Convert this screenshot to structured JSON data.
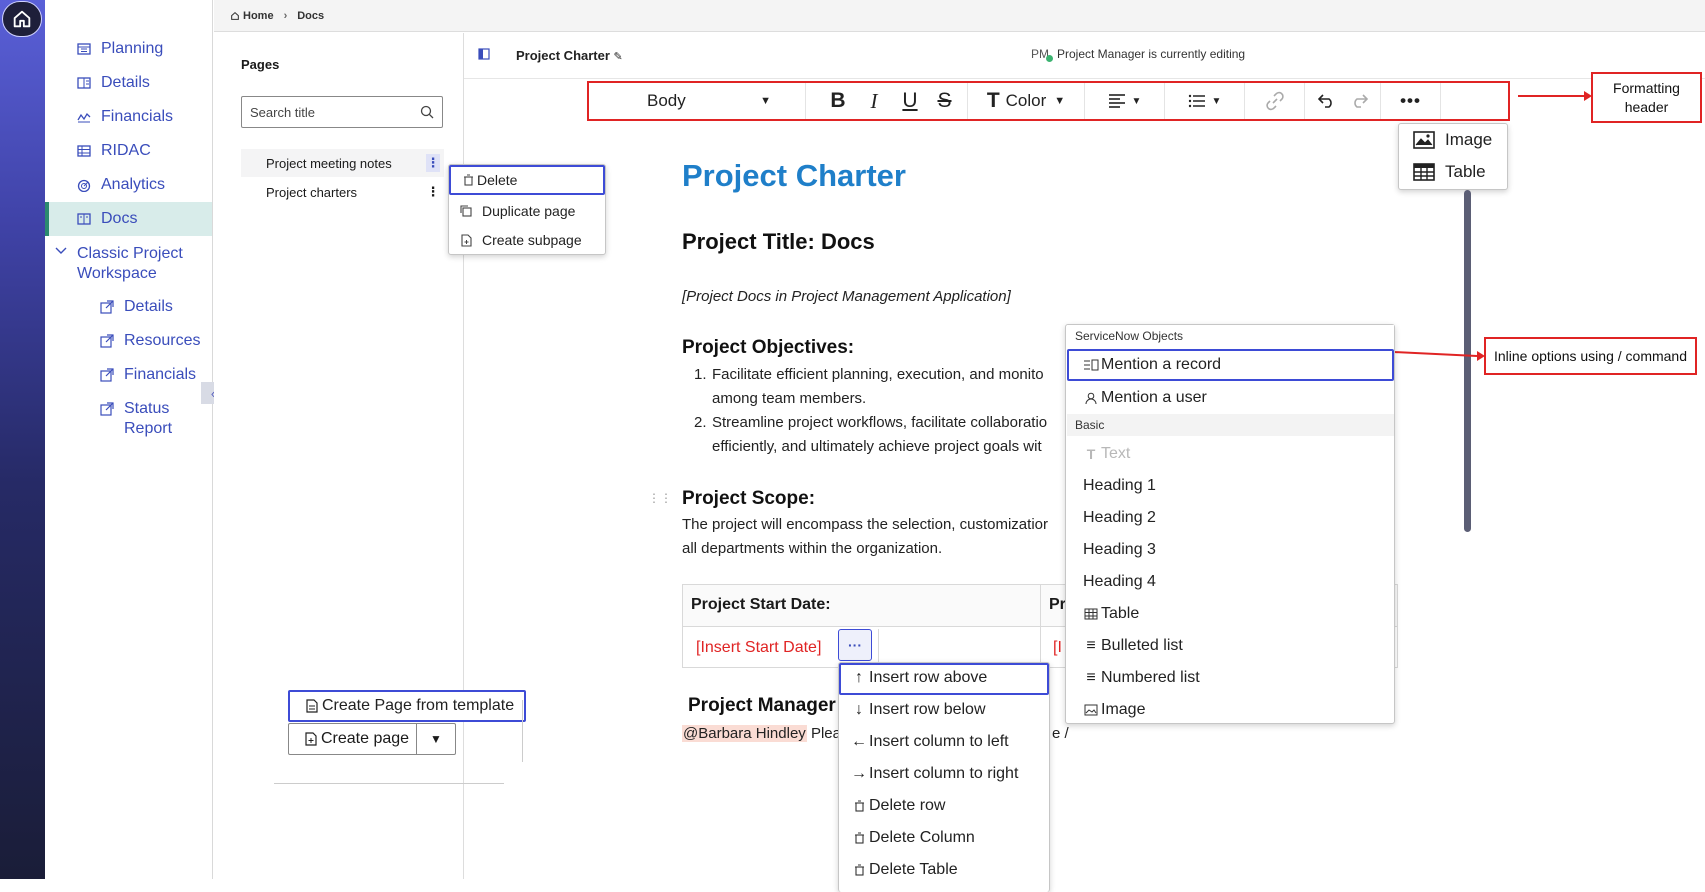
{
  "breadcrumb": {
    "home": "Home",
    "current": "Docs"
  },
  "nav": {
    "items": [
      {
        "label": "Planning",
        "icon": "planning-icon"
      },
      {
        "label": "Details",
        "icon": "details-icon"
      },
      {
        "label": "Financials",
        "icon": "financials-icon"
      },
      {
        "label": "RIDAC",
        "icon": "table-icon"
      },
      {
        "label": "Analytics",
        "icon": "analytics-icon"
      },
      {
        "label": "Docs",
        "icon": "docs-icon",
        "active": true
      }
    ],
    "group": {
      "label": "Classic Project Workspace",
      "expanded": true
    },
    "subitems": [
      {
        "label": "Details",
        "icon": "external-link-icon"
      },
      {
        "label": "Resources",
        "icon": "external-link-icon"
      },
      {
        "label": "Financials",
        "icon": "external-link-icon"
      },
      {
        "label": "Status Report",
        "icon": "external-link-icon"
      }
    ]
  },
  "pages": {
    "title": "Pages",
    "search_placeholder": "Search title",
    "items": [
      {
        "label": "Project meeting notes",
        "selected": true
      },
      {
        "label": "Project charters",
        "selected": false
      }
    ],
    "context_menu": [
      "Delete",
      "Duplicate page",
      "Create subpage"
    ],
    "template_button": "Create Page from template",
    "create_button": "Create page"
  },
  "editor": {
    "doc_title": "Project Charter",
    "presence_initials": "PM",
    "presence_text": "Project Manager is currently editing",
    "toolbar": {
      "style": "Body",
      "bold": "B",
      "italic": "I",
      "underline": "U",
      "strike": "S",
      "color_label": "Color"
    },
    "insert_menu": [
      "Image",
      "Table"
    ]
  },
  "annotations": {
    "formatting_header": "Formatting header",
    "inline_options": "Inline options using / command"
  },
  "document": {
    "title": "Project Charter",
    "project_title": "Project Title: Docs",
    "subtitle": "[Project Docs in Project Management Application]",
    "objectives_heading": "Project Objectives:",
    "objectives": [
      {
        "line1": "Facilitate efficient planning, execution, and monito",
        "line2": "among team members."
      },
      {
        "line1": "Streamline project workflows, facilitate collaboratio",
        "line2": "efficiently, and ultimately achieve project goals wit"
      }
    ],
    "scope_heading": "Project Scope:",
    "scope_line1": "The project will encompass the selection, customizatior",
    "scope_line2": "all departments within the organization.",
    "table": {
      "header_left": "Project Start Date:",
      "header_right": "Pr",
      "cell_left": "[Insert Start Date]",
      "cell_right": "[I",
      "cell_button": "···"
    },
    "manager_heading": "Project Manager",
    "mention": "@Barbara Hindley",
    "mention_tail": "Plea",
    "typed_tail": "e /"
  },
  "slash_menu": {
    "groups": [
      {
        "label": "ServiceNow Objects",
        "items": [
          {
            "label": "Mention a record",
            "icon": "record-icon",
            "highlighted": true
          },
          {
            "label": "Mention a user",
            "icon": "user-icon"
          }
        ]
      },
      {
        "label": "Basic",
        "items": [
          {
            "label": "Text",
            "icon": "text-icon",
            "disabled": true
          },
          {
            "label": "Heading 1"
          },
          {
            "label": "Heading 2"
          },
          {
            "label": "Heading 3"
          },
          {
            "label": "Heading 4"
          },
          {
            "label": "Table",
            "icon": "table-icon"
          },
          {
            "label": "Bulleted list",
            "icon": "list-icon"
          },
          {
            "label": "Numbered list",
            "icon": "list-icon"
          },
          {
            "label": "Image",
            "icon": "image-icon"
          }
        ]
      }
    ]
  },
  "row_menu": [
    {
      "label": "Insert row above",
      "icon": "arrow-up-icon"
    },
    {
      "label": "Insert row below",
      "icon": "arrow-down-icon"
    },
    {
      "label": "Insert column to left",
      "icon": "arrow-left-icon"
    },
    {
      "label": "Insert column to right",
      "icon": "arrow-right-icon"
    },
    {
      "label": "Delete row",
      "icon": "trash-icon"
    },
    {
      "label": "Delete Column",
      "icon": "trash-icon"
    },
    {
      "label": "Delete Table",
      "icon": "trash-icon"
    }
  ],
  "colors": {
    "accent": "#3a4dbb",
    "title": "#1f7fc9",
    "annotation": "#e02424",
    "active_nav": "#d8ecea",
    "placeholder_red": "#e02424"
  }
}
